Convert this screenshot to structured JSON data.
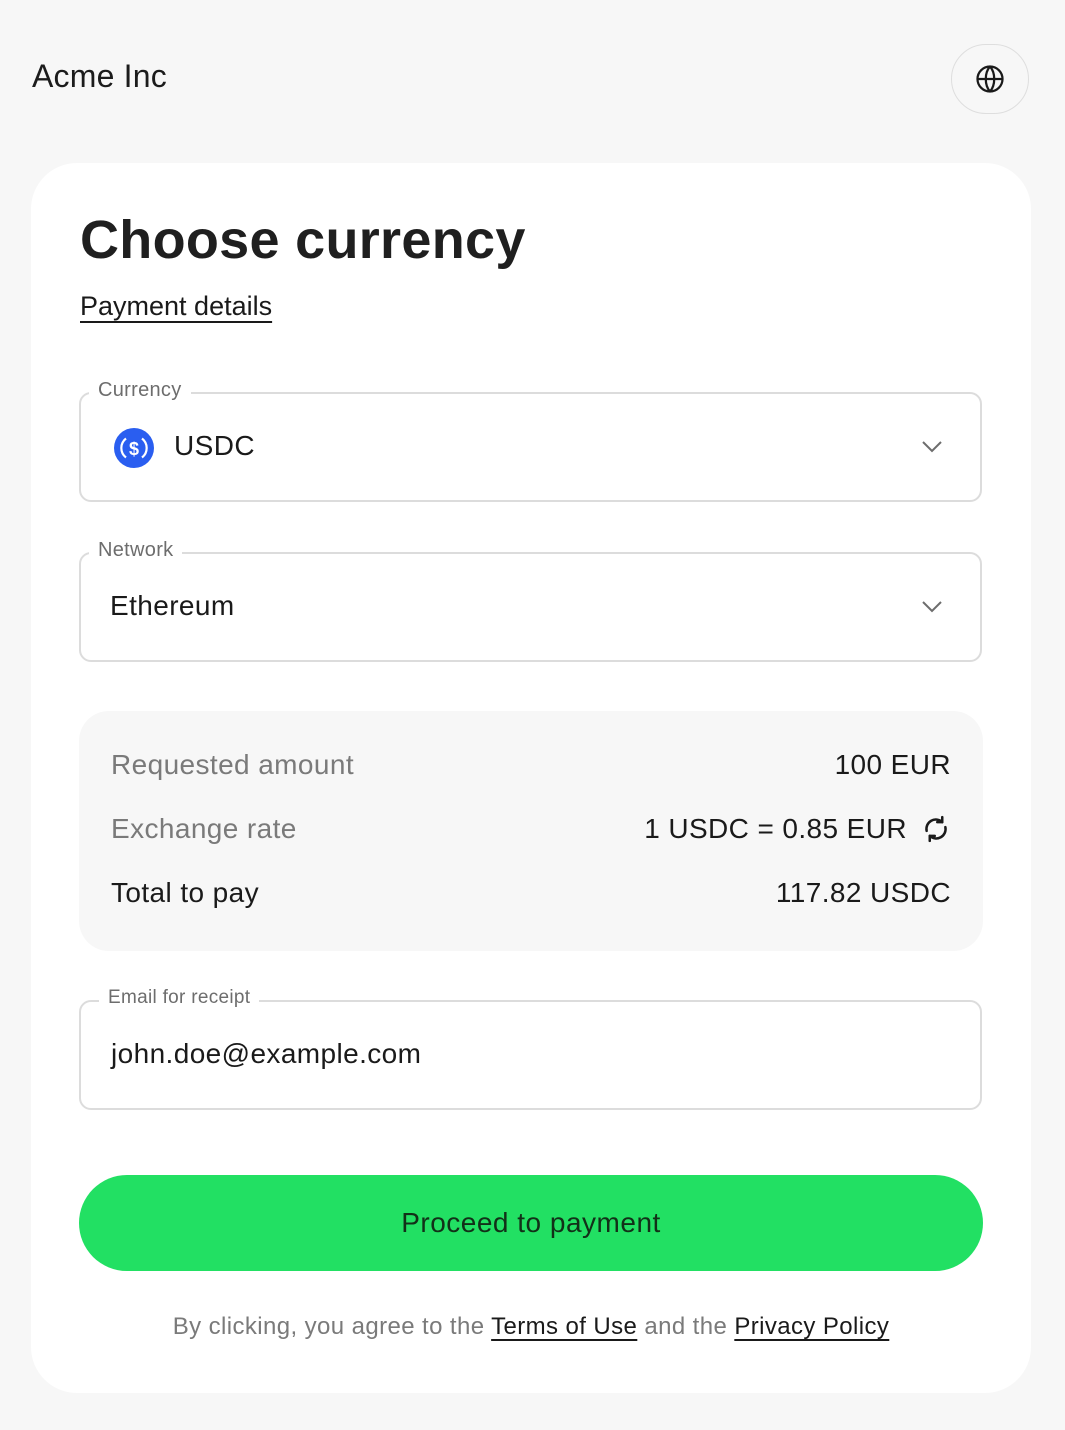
{
  "header": {
    "brand": "Acme Inc",
    "language_icon": "globe-icon"
  },
  "page": {
    "title": "Choose currency",
    "details_link": "Payment details"
  },
  "currency": {
    "label": "Currency",
    "value": "USDC",
    "icon": "usdc-coin-icon",
    "icon_color": "#2a5ef0"
  },
  "network": {
    "label": "Network",
    "value": "Ethereum"
  },
  "summary": {
    "requested_label": "Requested amount",
    "requested_value": "100 EUR",
    "rate_label": "Exchange rate",
    "rate_value": "1 USDC = 0.85 EUR",
    "total_label": "Total to pay",
    "total_value": "117.82 USDC"
  },
  "email": {
    "label": "Email for receipt",
    "value": "john.doe@example.com"
  },
  "cta": {
    "label": "Proceed to payment",
    "color": "#22e063"
  },
  "legal": {
    "prefix": "By clicking, you agree to the ",
    "terms": "Terms of Use",
    "middle": " and the ",
    "privacy": "Privacy Policy"
  }
}
